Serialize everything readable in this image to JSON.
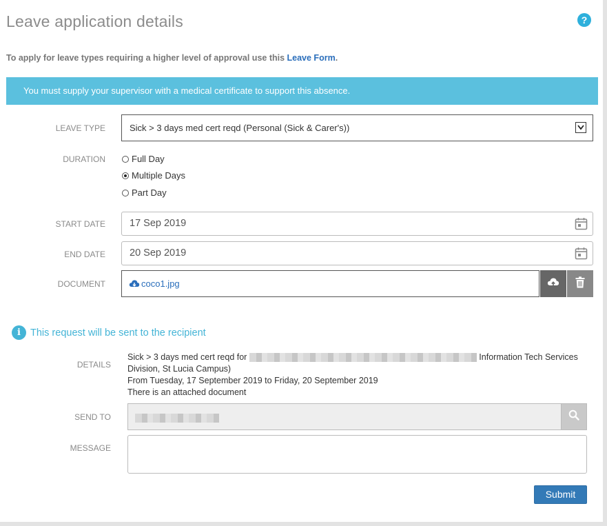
{
  "page": {
    "title": "Leave application details",
    "help_icon": "?"
  },
  "intro": {
    "text": "To apply for leave types requiring a higher level of approval use this ",
    "link_label": "Leave Form",
    "suffix": "."
  },
  "alert": {
    "text": "You must supply your supervisor with a medical certificate to support this absence.",
    "color": "#5bc0de"
  },
  "form": {
    "leave_type": {
      "label": "LEAVE TYPE",
      "value": "Sick > 3 days med cert reqd (Personal (Sick & Carer's))"
    },
    "duration": {
      "label": "DURATION",
      "options": [
        {
          "label": "Full Day",
          "selected": false
        },
        {
          "label": "Multiple Days",
          "selected": true
        },
        {
          "label": "Part Day",
          "selected": false
        }
      ]
    },
    "start_date": {
      "label": "START DATE",
      "value": "17 Sep 2019"
    },
    "end_date": {
      "label": "END DATE",
      "value": "20 Sep 2019"
    },
    "document": {
      "label": "DOCUMENT",
      "file_name": "coco1.jpg"
    }
  },
  "recipient": {
    "info_text": "This request will be sent to the recipient",
    "details_label": "DETAILS",
    "details": {
      "line1_prefix": "Sick > 3 days med cert reqd for ",
      "line1_suffix": " Information Tech Services",
      "line2": "Division, St Lucia Campus)",
      "line3": "From Tuesday, 17 September 2019 to Friday, 20 September 2019",
      "line4": "There is an attached document"
    },
    "send_to_label": "SEND TO",
    "message_label": "MESSAGE"
  },
  "actions": {
    "submit_label": "Submit",
    "submit_color": "#337ab7"
  }
}
